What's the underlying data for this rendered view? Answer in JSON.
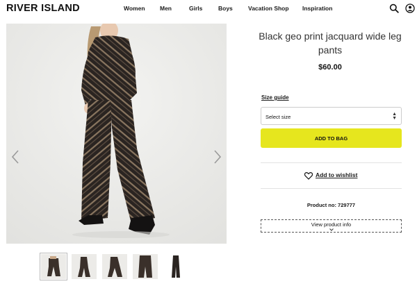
{
  "header": {
    "logo": "RIVER ISLAND",
    "nav": [
      "Women",
      "Men",
      "Girls",
      "Boys",
      "Vacation Shop",
      "Inspiration"
    ],
    "icons": [
      "search-icon",
      "account-icon"
    ]
  },
  "gallery": {
    "prev_icon": "chevron-left-icon",
    "next_icon": "chevron-right-icon",
    "thumbnail_count": 5
  },
  "product": {
    "title": "Black geo print jacquard wide leg pants",
    "price": "$60.00",
    "size_guide": "Size guide",
    "size_select": "Select size",
    "add_to_bag": "ADD TO BAG",
    "wishlist": "Add to wishlist",
    "product_no": "Product no: 729777",
    "view_info": "View product info"
  },
  "colors": {
    "accent": "#e6e61e"
  }
}
